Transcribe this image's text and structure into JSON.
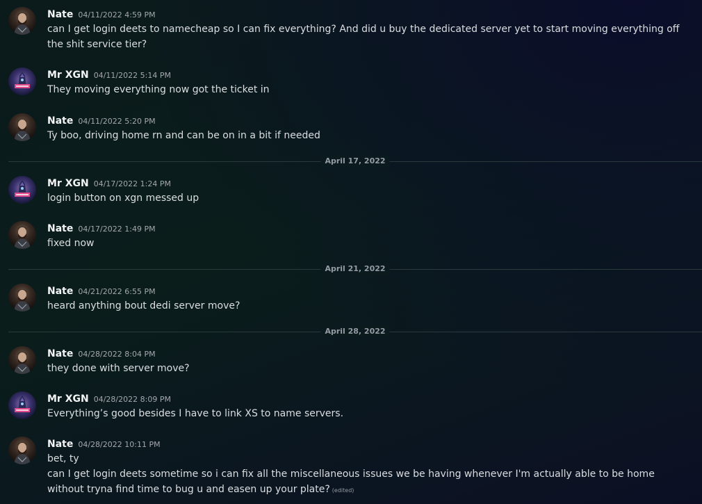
{
  "messages": [
    {
      "author": "Nate",
      "timestamp": "04/11/2022 4:59 PM",
      "lines": [
        "can I get login deets to namecheap so I can fix everything? And did u buy the dedicated server yet to start moving everything off the shit service tier?"
      ],
      "avatar": "nate-avatar"
    },
    {
      "author": "Mr XGN",
      "timestamp": "04/11/2022 5:14 PM",
      "lines": [
        "They moving everything now got the ticket in"
      ],
      "avatar": "mr-xgn-avatar"
    },
    {
      "author": "Nate",
      "timestamp": "04/11/2022 5:20 PM",
      "lines": [
        "Ty boo, driving home rn and can be on in a bit if needed"
      ],
      "avatar": "nate-avatar"
    },
    {
      "author": "Mr XGN",
      "timestamp": "04/17/2022 1:24 PM",
      "lines": [
        "login button on xgn messed up"
      ],
      "avatar": "mr-xgn-avatar"
    },
    {
      "author": "Nate",
      "timestamp": "04/17/2022 1:49 PM",
      "lines": [
        "fixed now"
      ],
      "avatar": "nate-avatar"
    },
    {
      "author": "Nate",
      "timestamp": "04/21/2022 6:55 PM",
      "lines": [
        "heard anything bout dedi server move?"
      ],
      "avatar": "nate-avatar"
    },
    {
      "author": "Nate",
      "timestamp": "04/28/2022 8:04 PM",
      "lines": [
        "they done with server move?"
      ],
      "avatar": "nate-avatar"
    },
    {
      "author": "Mr XGN",
      "timestamp": "04/28/2022 8:09 PM",
      "lines": [
        "Everything’s good besides I have to link XS to name servers."
      ],
      "avatar": "mr-xgn-avatar"
    },
    {
      "author": "Nate",
      "timestamp": "04/28/2022 10:11 PM",
      "lines": [
        "bet, ty",
        "can I get login deets sometime so i can fix all the miscellaneous issues we be having whenever I'm actually able to be home without tryna find time to bug u and easen up your plate?"
      ],
      "edited": "(edited)",
      "avatar": "nate-avatar"
    }
  ],
  "dividers": [
    "April 17, 2022",
    "April 21, 2022",
    "April 28, 2022"
  ],
  "colors": {
    "author": "#f2f3f5",
    "timestamp": "#a4a8ae",
    "text": "#dbdee1",
    "divider": "#2b3a3c"
  }
}
